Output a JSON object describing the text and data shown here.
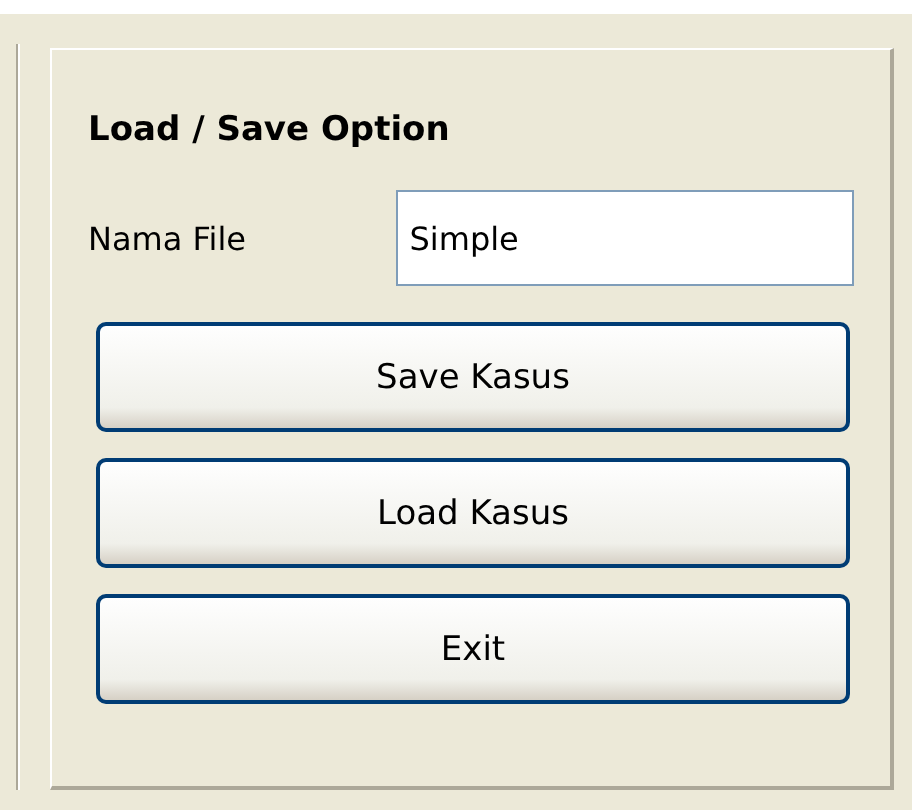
{
  "panel": {
    "title": "Load / Save Option",
    "file_label": "Nama File",
    "file_value": "Simple"
  },
  "buttons": [
    "Save Kasus",
    "Load Kasus",
    "Exit"
  ]
}
